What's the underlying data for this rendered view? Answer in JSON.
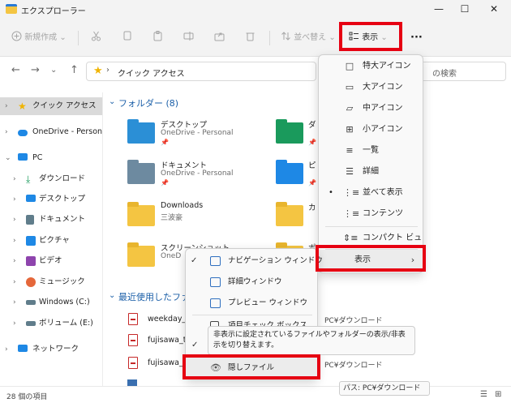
{
  "window": {
    "title": "エクスプローラー",
    "minimize": "—",
    "maximize": "☐",
    "close": "✕"
  },
  "toolbar": {
    "new_label": "新規作成",
    "new_chev": "⌄",
    "sort_label": "並べ替え",
    "view_label": "表示",
    "view_chev": "⌄",
    "more_label": "···",
    "accent": "#e60012"
  },
  "address": {
    "path": "クイック アクセス",
    "chevron": "›",
    "search_placeholder": "の検索"
  },
  "sidebar": {
    "items": [
      {
        "label": "クイック アクセス",
        "icon": "star-icon",
        "color": "#f0b400"
      },
      {
        "label": "OneDrive - Personal",
        "icon": "cloud-icon",
        "color": "#1e88e5"
      },
      {
        "label": "PC",
        "icon": "pc-icon",
        "color": "#1e88e5"
      },
      {
        "label": "ダウンロード",
        "icon": "download-icon",
        "color": "#1a9a5c"
      },
      {
        "label": "デスクトップ",
        "icon": "desktop-icon",
        "color": "#1e88e5"
      },
      {
        "label": "ドキュメント",
        "icon": "document-icon",
        "color": "#607d8b"
      },
      {
        "label": "ピクチャ",
        "icon": "picture-icon",
        "color": "#1e88e5"
      },
      {
        "label": "ビデオ",
        "icon": "video-icon",
        "color": "#8e44ad"
      },
      {
        "label": "ミュージック",
        "icon": "music-icon",
        "color": "#e5673a"
      },
      {
        "label": "Windows (C:)",
        "icon": "drive-icon",
        "color": "#607d8b"
      },
      {
        "label": "ボリューム (E:)",
        "icon": "drive-icon",
        "color": "#607d8b"
      },
      {
        "label": "ネットワーク",
        "icon": "network-icon",
        "color": "#1e88e5"
      }
    ]
  },
  "content": {
    "folders_header": "フォルダー (8)",
    "recent_header": "最近使用したファ",
    "folders": [
      {
        "name": "デスクトップ",
        "sub": "OneDrive - Personal",
        "color": "#2b8fd6"
      },
      {
        "name": "ダ",
        "sub": "",
        "color": "#1a9a5c"
      },
      {
        "name": "ドキュメント",
        "sub": "OneDrive - Personal",
        "color": "#6d8aa0"
      },
      {
        "name": "ピ",
        "sub": "",
        "color": "#1e88e5"
      },
      {
        "name": "Downloads",
        "sub": "三波豪",
        "color": "#f4c542"
      },
      {
        "name": "カ",
        "sub": "",
        "color": "#f4c542"
      },
      {
        "name": "スクリーンショット",
        "sub": "OneD",
        "color": "#f4c542"
      },
      {
        "name": "ポ",
        "sub": "",
        "color": "#f4c542"
      }
    ],
    "recent": [
      {
        "name": "weekday_c",
        "path": "PC¥ダウンロード"
      },
      {
        "name": "fujisawa_t",
        "path": ""
      },
      {
        "name": "fujisawa_t",
        "path": "PC¥ダウンロード"
      }
    ]
  },
  "view_menu": {
    "items": [
      {
        "label": "特大アイコン",
        "icon": "□"
      },
      {
        "label": "大アイコン",
        "icon": "▭"
      },
      {
        "label": "中アイコン",
        "icon": "▱"
      },
      {
        "label": "小アイコン",
        "icon": "⊞"
      },
      {
        "label": "一覧",
        "icon": "≡"
      },
      {
        "label": "詳細",
        "icon": "☰"
      },
      {
        "label": "並べて表示",
        "icon": "⋮≡",
        "selected": true
      },
      {
        "label": "コンテンツ",
        "icon": "⋮≡"
      },
      {
        "label": "コンパクト ビュー",
        "icon": "⇕≡"
      },
      {
        "label": "表示",
        "icon": "›"
      }
    ],
    "selected_bullet": "•"
  },
  "submenu": {
    "items": [
      {
        "label": "ナビゲーション ウィンドウ",
        "checked": true
      },
      {
        "label": "詳細ウィンドウ",
        "checked": false
      },
      {
        "label": "プレビュー ウィンドウ",
        "checked": false
      },
      {
        "label": "項目チェック ボックス",
        "checked": false
      },
      {
        "label": "隠しファイル",
        "checked": false
      }
    ],
    "check_mark": "✓",
    "tooltip": "非表示に設定されているファイルやフォルダーの表示/非表示を切り替えます。",
    "tooltip_check": "✓"
  },
  "path_tooltip": "パス: PC¥ダウンロード",
  "status": {
    "count": "28 個の項目"
  }
}
